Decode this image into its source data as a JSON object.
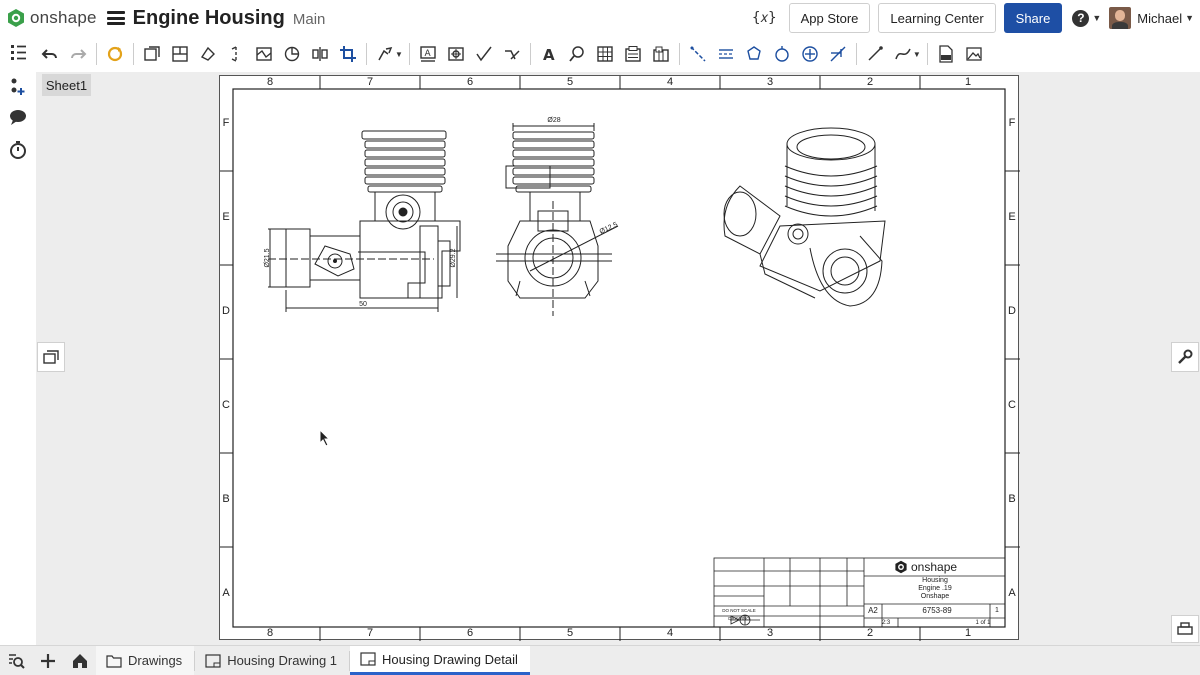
{
  "header": {
    "brand_name": "onshape",
    "doc_title": "Engine Housing",
    "branch": "Main",
    "variable_label": "{𝑥}",
    "app_store": "App Store",
    "learning_center": "Learning Center",
    "share": "Share",
    "help_label": "?",
    "user_name": "Michael"
  },
  "sheet_tab": "Sheet1",
  "drawing": {
    "column_labels": [
      "8",
      "7",
      "6",
      "5",
      "4",
      "3",
      "2",
      "1"
    ],
    "row_labels": [
      "F",
      "E",
      "D",
      "C",
      "B",
      "A"
    ],
    "dimensions": {
      "front_width": "50",
      "left_dia": "Ø21.5",
      "right_dia": "Ø29.2",
      "top_dia": "Ø28",
      "bore_dia": "Ø12.5"
    },
    "title_block": {
      "company": "onshape",
      "title_line1": "Housing",
      "title_line2": "Engine .19",
      "title_line3": "Onshape",
      "size": "A2",
      "dwg_no": "6753-89",
      "rev": "1",
      "sheet": "1 of 1",
      "scale": "2:3",
      "do_not_scale": "DO NOT SCALE DRAWING"
    }
  },
  "bottom_tabs": {
    "folder": "Drawings",
    "tab1": "Housing Drawing 1",
    "tab2": "Housing Drawing Detail"
  },
  "colors": {
    "accent_blue": "#1e4fa5",
    "tab_underline": "#2a62c9",
    "brand_green": "#3aa04a"
  }
}
